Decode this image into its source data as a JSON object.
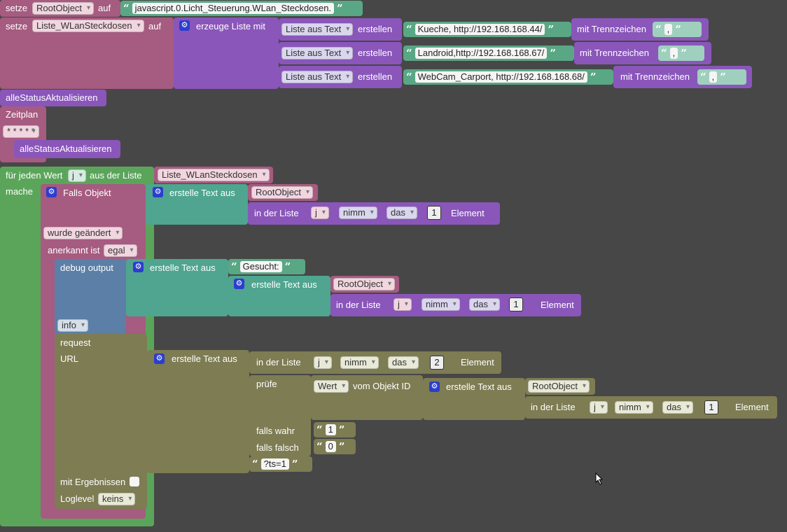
{
  "row1": {
    "label": "setze",
    "var": "RootObject",
    "auf": "auf",
    "value": "javascript.0.Licht_Steuerung.WLan_Steckdosen."
  },
  "row2": {
    "label": "setze",
    "var": "Liste_WLanSteckdosen",
    "auf": "auf",
    "create_list": "erzeuge Liste mit"
  },
  "list_items": [
    {
      "kind": "Liste aus Text",
      "erstellen": "erstellen",
      "text": "Kueche, http://192.168.168.44/",
      "sep_label": "mit Trennzeichen",
      "sep": ","
    },
    {
      "kind": "Liste aus Text",
      "erstellen": "erstellen",
      "text": "Landroid,http://192.168.168.67/",
      "sep_label": "mit Trennzeichen",
      "sep": ","
    },
    {
      "kind": "Liste aus Text",
      "erstellen": "erstellen",
      "text": "WebCam_Carport, http://192.168.168.68/",
      "sep_label": "mit Trennzeichen",
      "sep": ","
    }
  ],
  "proc_call": "alleStatusAktualisieren",
  "schedule": {
    "label": "Zeitplan",
    "cron": "* * * * *",
    "call": "alleStatusAktualisieren"
  },
  "loop": {
    "label": "für jeden Wert",
    "var": "j",
    "from_list": "aus der Liste",
    "list": "Liste_WLanSteckdosen",
    "do": "mache"
  },
  "trigger": {
    "label": "Falls Objekt",
    "text_join": "erstelle Text aus",
    "first": "RootObject",
    "in_list": "in der Liste",
    "var": "j",
    "take": "nimm",
    "the": "das",
    "index": "1",
    "element": "Element",
    "changed": "wurde geändert",
    "ack_label": "anerkannt ist",
    "ack": "egal"
  },
  "debug": {
    "label": "debug output",
    "text_join": "erstelle Text aus",
    "prefix": "Gesucht:",
    "text_join2": "erstelle Text aus",
    "root": "RootObject",
    "in_list": "in der Liste",
    "var": "j",
    "take": "nimm",
    "the": "das",
    "index": "1",
    "element": "Element",
    "level": "info"
  },
  "request": {
    "label": "request",
    "url_label": "URL",
    "text_join": "erstelle Text aus",
    "in_list": "in der Liste",
    "var": "j",
    "take": "nimm",
    "the": "das",
    "index": "2",
    "element": "Element",
    "check": "prüfe",
    "value_label": "Wert",
    "of_object": "vom Objekt ID",
    "text_join2": "erstelle Text aus",
    "root": "RootObject",
    "in_list2": "in der Liste",
    "var2": "j",
    "take2": "nimm",
    "the2": "das",
    "index2": "1",
    "element2": "Element",
    "if_true": "falls wahr",
    "true_val": "1",
    "if_false": "falls falsch",
    "false_val": "0",
    "suffix": "?ts=1",
    "results_label": "mit Ergebnissen",
    "loglevel_label": "Loglevel",
    "loglevel": "keins"
  },
  "colors": {
    "background": "#474747",
    "loop": "#5ba55b",
    "variable": "#a65b80",
    "list": "#8a56ba",
    "text": "#4fa58f",
    "debug": "#5b7fa6",
    "request": "#7d7c53"
  }
}
